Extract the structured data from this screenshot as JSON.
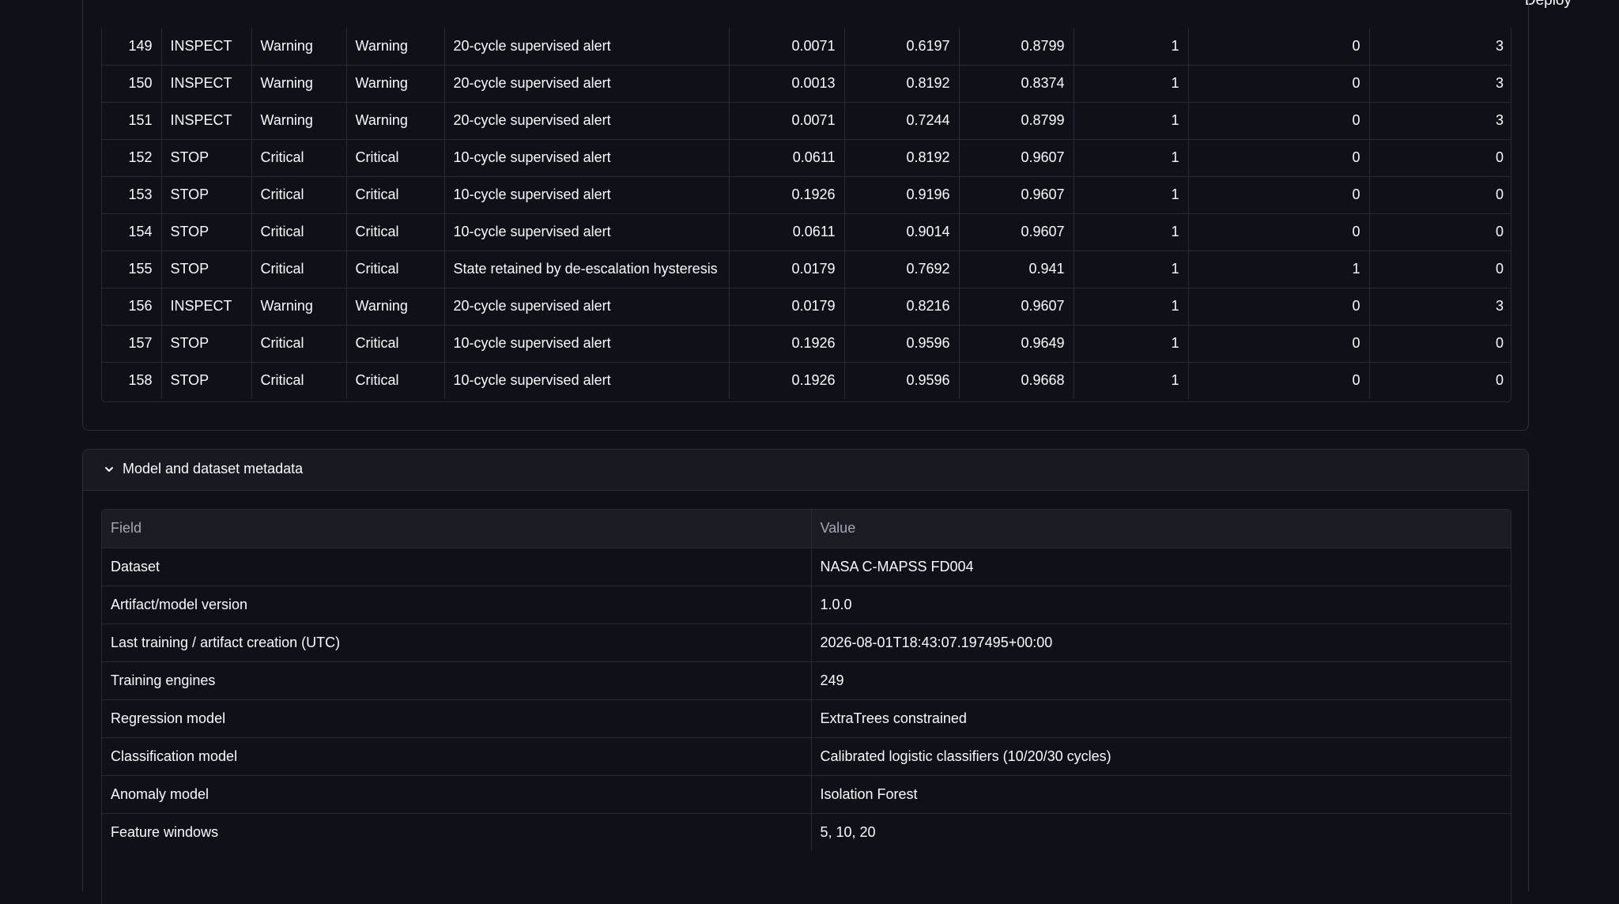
{
  "topbar": {
    "deploy_label": "Deploy"
  },
  "alerts": {
    "rows": [
      [
        "149",
        "INSPECT",
        "Warning",
        "Warning",
        "20-cycle supervised alert",
        "0.0071",
        "0.6197",
        "0.8799",
        "1",
        "0",
        "3"
      ],
      [
        "150",
        "INSPECT",
        "Warning",
        "Warning",
        "20-cycle supervised alert",
        "0.0013",
        "0.8192",
        "0.8374",
        "1",
        "0",
        "3"
      ],
      [
        "151",
        "INSPECT",
        "Warning",
        "Warning",
        "20-cycle supervised alert",
        "0.0071",
        "0.7244",
        "0.8799",
        "1",
        "0",
        "3"
      ],
      [
        "152",
        "STOP",
        "Critical",
        "Critical",
        "10-cycle supervised alert",
        "0.0611",
        "0.8192",
        "0.9607",
        "1",
        "0",
        "0"
      ],
      [
        "153",
        "STOP",
        "Critical",
        "Critical",
        "10-cycle supervised alert",
        "0.1926",
        "0.9196",
        "0.9607",
        "1",
        "0",
        "0"
      ],
      [
        "154",
        "STOP",
        "Critical",
        "Critical",
        "10-cycle supervised alert",
        "0.0611",
        "0.9014",
        "0.9607",
        "1",
        "0",
        "0"
      ],
      [
        "155",
        "STOP",
        "Critical",
        "Critical",
        "State retained by de-escalation hysteresis",
        "0.0179",
        "0.7692",
        "0.941",
        "1",
        "1",
        "0"
      ],
      [
        "156",
        "INSPECT",
        "Warning",
        "Warning",
        "20-cycle supervised alert",
        "0.0179",
        "0.8216",
        "0.9607",
        "1",
        "0",
        "3"
      ],
      [
        "157",
        "STOP",
        "Critical",
        "Critical",
        "10-cycle supervised alert",
        "0.1926",
        "0.9596",
        "0.9649",
        "1",
        "0",
        "0"
      ],
      [
        "158",
        "STOP",
        "Critical",
        "Critical",
        "10-cycle supervised alert",
        "0.1926",
        "0.9596",
        "0.9668",
        "1",
        "0",
        "0"
      ]
    ]
  },
  "metadata": {
    "expander_title": "Model and dataset metadata",
    "headers": {
      "field": "Field",
      "value": "Value"
    },
    "rows": [
      {
        "field": "Dataset",
        "value": "NASA C-MAPSS FD004"
      },
      {
        "field": "Artifact/model version",
        "value": "1.0.0"
      },
      {
        "field": "Last training / artifact creation (UTC)",
        "value": "2026-08-01T18:43:07.197495+00:00"
      },
      {
        "field": "Training engines",
        "value": "249"
      },
      {
        "field": "Regression model",
        "value": "ExtraTrees constrained"
      },
      {
        "field": "Classification model",
        "value": "Calibrated logistic classifiers (10/20/30 cycles)"
      },
      {
        "field": "Anomaly model",
        "value": "Isolation Forest"
      },
      {
        "field": "Feature windows",
        "value": "5, 10, 20"
      }
    ]
  }
}
